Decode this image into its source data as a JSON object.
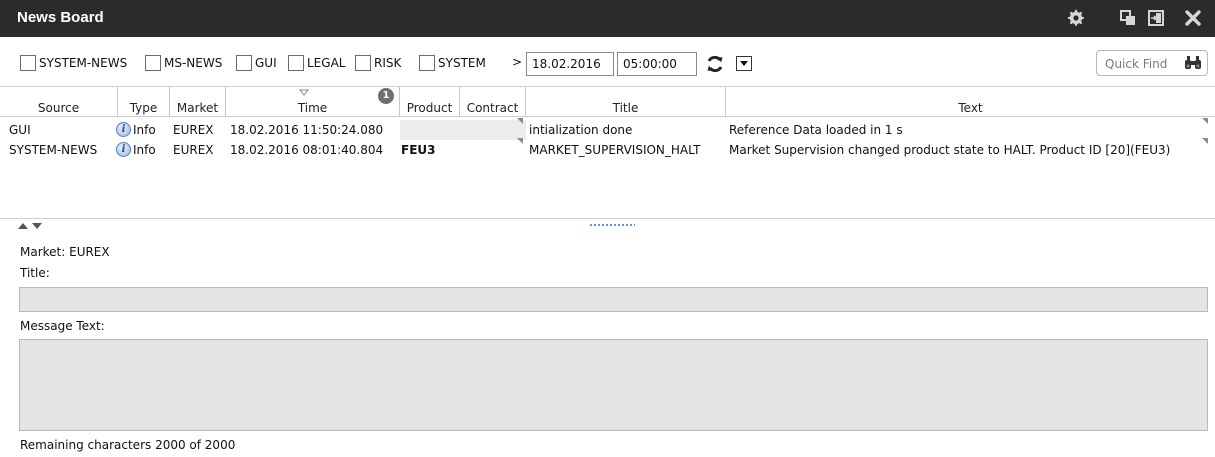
{
  "window": {
    "title": "News Board",
    "icons": [
      "gear-icon",
      "restore-window-icon",
      "pin-window-icon",
      "close-icon"
    ]
  },
  "filters": {
    "checkboxes": [
      {
        "label": "SYSTEM-NEWS",
        "checked": false
      },
      {
        "label": "MS-NEWS",
        "checked": false
      },
      {
        "label": "GUI",
        "checked": false
      },
      {
        "label": "LEGAL",
        "checked": false
      },
      {
        "label": "RISK",
        "checked": false
      },
      {
        "label": "SYSTEM",
        "checked": false
      }
    ],
    "operator": ">",
    "date": "18.02.2016",
    "time": "05:00:00",
    "quick_find_placeholder": "Quick Find"
  },
  "table": {
    "columns": [
      "Source",
      "Type",
      "Market",
      "Time",
      "Product",
      "Contract",
      "Title",
      "Text"
    ],
    "filter_count": "1",
    "rows": [
      {
        "source": "GUI",
        "type": "Info",
        "market": "EUREX",
        "time": "18.02.2016 11:50:24.080",
        "product": "",
        "contract": "",
        "title": "intialization done",
        "text": "Reference Data loaded in 1 s"
      },
      {
        "source": "SYSTEM-NEWS",
        "type": "Info",
        "market": "EUREX",
        "time": "18.02.2016 08:01:40.804",
        "product": "FEU3",
        "contract": "",
        "title": "MARKET_SUPERVISION_HALT",
        "text": "Market Supervision changed product state to HALT. Product ID [20](FEU3)"
      }
    ]
  },
  "detail": {
    "market_line": "Market: EUREX",
    "title_label": "Title:",
    "title_value": "",
    "message_label": "Message Text:",
    "message_value": "",
    "remaining": "Remaining characters  2000 of 2000"
  },
  "colors": {
    "titlebar_bg": "#2b2b2b",
    "field_bg": "#e4e4e4",
    "info_icon": "#9bb8e6"
  }
}
